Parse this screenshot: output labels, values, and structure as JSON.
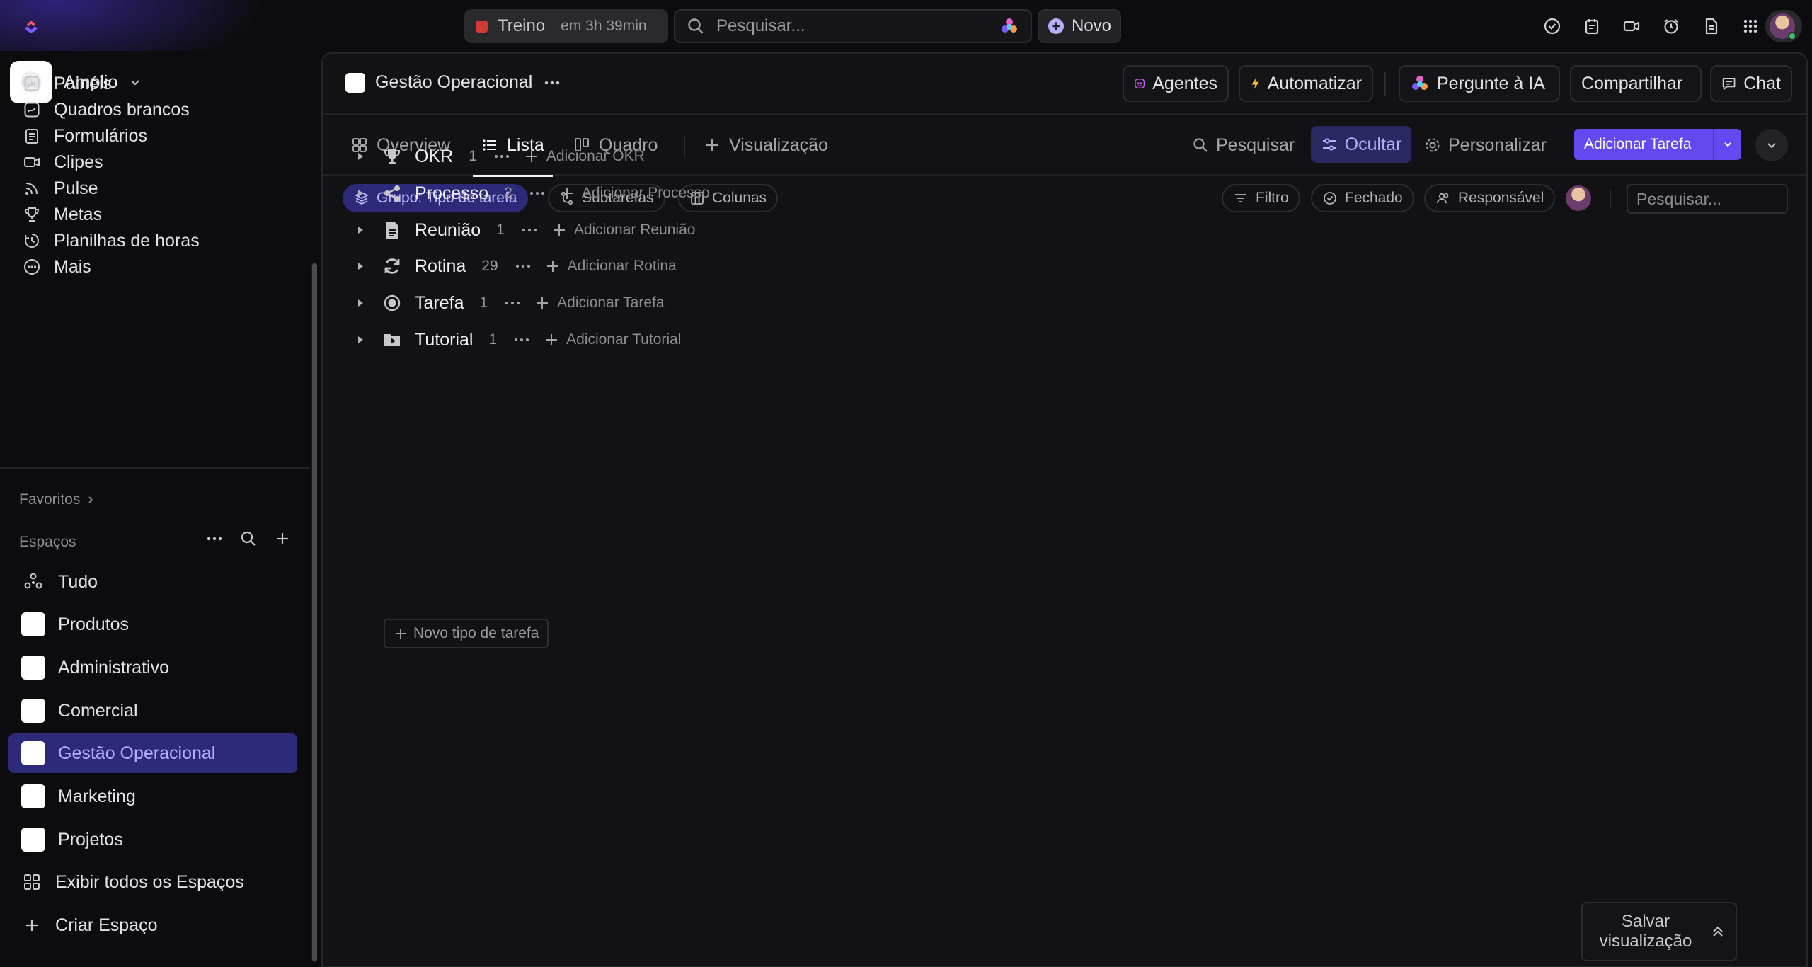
{
  "topbar": {
    "timer_label": "Treino",
    "timer_remaining": "em 3h 39min",
    "search_placeholder": "Pesquisar...",
    "new_label": "Novo"
  },
  "workspace": {
    "name": "Amplio"
  },
  "sidebar": {
    "nav": [
      {
        "label": "Painéis",
        "icon": "dashboard-icon"
      },
      {
        "label": "Quadros brancos",
        "icon": "whiteboard-icon"
      },
      {
        "label": "Formulários",
        "icon": "form-icon"
      },
      {
        "label": "Clipes",
        "icon": "video-icon"
      },
      {
        "label": "Pulse",
        "icon": "pulse-icon"
      },
      {
        "label": "Metas",
        "icon": "trophy-icon"
      },
      {
        "label": "Planilhas de horas",
        "icon": "timesheet-icon"
      },
      {
        "label": "Mais",
        "icon": "more-circle-icon"
      }
    ],
    "favorites_label": "Favoritos",
    "spaces_label": "Espaços",
    "all_label": "Tudo",
    "spaces": [
      {
        "label": "Produtos"
      },
      {
        "label": "Administrativo"
      },
      {
        "label": "Comercial"
      },
      {
        "label": "Gestão Operacional"
      },
      {
        "label": "Marketing"
      },
      {
        "label": "Projetos"
      }
    ],
    "active_space": "Gestão Operacional",
    "show_all_label": "Exibir todos os Espaços",
    "create_label": "Criar Espaço"
  },
  "header": {
    "title": "Gestão Operacional",
    "buttons": {
      "agents": "Agentes",
      "automate": "Automatizar",
      "ask_ai": "Pergunte à IA",
      "share": "Compartilhar",
      "chat": "Chat"
    }
  },
  "views": {
    "tabs": [
      "Overview",
      "Lista",
      "Quadro"
    ],
    "active": "Lista",
    "add_view": "Visualização",
    "search": "Pesquisar",
    "hide": "Ocultar",
    "customize": "Personalizar",
    "add_task": "Adicionar Tarefa"
  },
  "filters": {
    "group": "Grupo: Tipo de tarefa",
    "subtasks": "Subtarefas",
    "columns": "Colunas",
    "filter": "Filtro",
    "closed": "Fechado",
    "assignee": "Responsável",
    "search_placeholder": "Pesquisar..."
  },
  "groups": [
    {
      "name": "OKR",
      "count": "1",
      "add": "Adicionar OKR",
      "icon": "trophy-icon"
    },
    {
      "name": "Processo",
      "count": "2",
      "add": "Adicionar Processo",
      "icon": "share-nodes-icon"
    },
    {
      "name": "Reunião",
      "count": "1",
      "add": "Adicionar Reunião",
      "icon": "document-icon"
    },
    {
      "name": "Rotina",
      "count": "29",
      "add": "Adicionar Rotina",
      "icon": "refresh-icon"
    },
    {
      "name": "Tarefa",
      "count": "1",
      "add": "Adicionar Tarefa",
      "icon": "target-icon"
    },
    {
      "name": "Tutorial",
      "count": "1",
      "add": "Adicionar Tutorial",
      "icon": "play-folder-icon"
    }
  ],
  "new_type_label": "Novo tipo de tarefa",
  "save_view_label": "Salvar visualização",
  "colors": {
    "accent": "#6448f0",
    "active_bg": "#2e2a7a",
    "active_text": "#b6b0ff"
  }
}
